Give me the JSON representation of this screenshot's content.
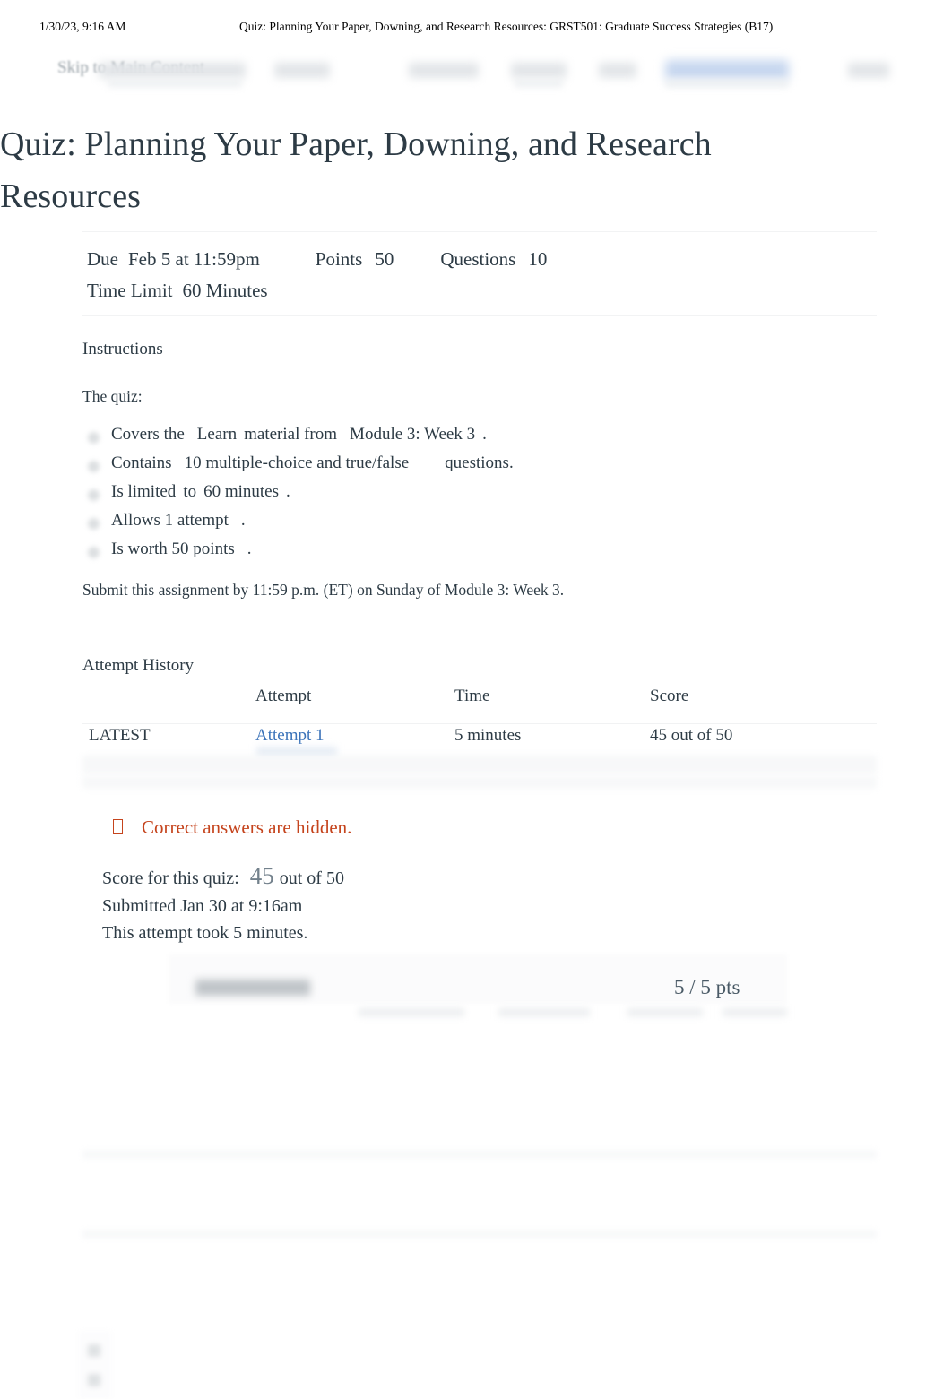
{
  "print_header": {
    "timestamp": "1/30/23, 9:16 AM",
    "document_title": "Quiz: Planning Your Paper, Downing, and Research Resources: GRST501: Graduate Success Strategies (B17)"
  },
  "nav": {
    "skip_link": "Skip to Main Content"
  },
  "page": {
    "title": "Quiz: Planning Your Paper, Downing, and Research Resources"
  },
  "meta": {
    "due_label": "Due",
    "due_value": "Feb 5 at 11:59pm",
    "points_label": "Points",
    "points_value": "50",
    "questions_label": "Questions",
    "questions_value": "10",
    "time_limit_label": "Time Limit",
    "time_limit_value": "60 Minutes"
  },
  "instructions": {
    "heading": "Instructions",
    "intro": "The quiz:",
    "bullets": [
      {
        "a": "Covers the",
        "b": "Learn",
        "c": "material from",
        "d": "Module 3: Week 3",
        "e": "."
      },
      {
        "a": "Contains",
        "b": "10 multiple-choice and true/false",
        "c": "questions.",
        "d": "",
        "e": ""
      },
      {
        "a": "Is limited",
        "b": "to",
        "c": "60 minutes",
        "d": ".",
        "e": ""
      },
      {
        "a": "Allows 1 attempt",
        "b": ".",
        "c": "",
        "d": "",
        "e": ""
      },
      {
        "a": "Is worth 50 points",
        "b": ".",
        "c": "",
        "d": "",
        "e": ""
      }
    ],
    "submit_note": "Submit this assignment by 11:59 p.m. (ET) on Sunday of Module 3: Week 3."
  },
  "attempt_history": {
    "heading": "Attempt History",
    "columns": [
      "",
      "Attempt",
      "Time",
      "Score"
    ],
    "rows": [
      {
        "label": "LATEST",
        "attempt": "Attempt 1",
        "time": "5 minutes",
        "score": "45 out of 50"
      }
    ]
  },
  "results": {
    "hidden_warning": "Correct answers are hidden.",
    "score_prefix": "Score for this quiz:",
    "score_value": "45",
    "score_suffix": "out of 50",
    "submitted": "Submitted Jan 30 at 9:16am",
    "duration": "This attempt took 5 minutes."
  },
  "question": {
    "points": "5 / 5 pts"
  },
  "colors": {
    "link": "#3b73b9",
    "warning": "#c5441d",
    "text": "#2d3b45",
    "score_value": "#73818c"
  }
}
